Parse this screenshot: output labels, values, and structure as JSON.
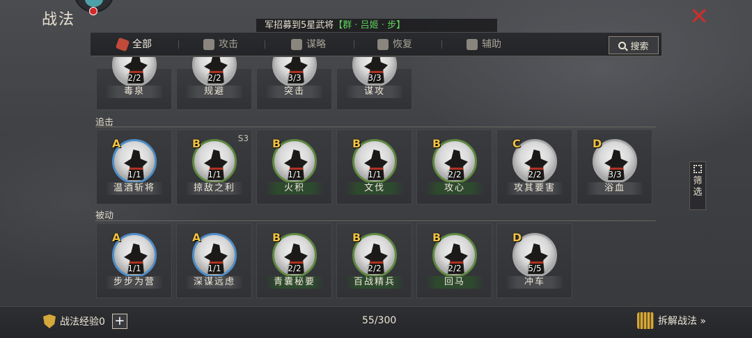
{
  "header": {
    "title": "战法",
    "marquee_prefix": "军招募到5星武将",
    "marquee_highlight": "【群 · 吕姬 · 步】"
  },
  "tabs": [
    {
      "label": "全部",
      "icon": "scroll-icon",
      "active": true
    },
    {
      "label": "攻击",
      "icon": "crossed-swords-icon",
      "active": false
    },
    {
      "label": "谋略",
      "icon": "fan-icon",
      "active": false
    },
    {
      "label": "恢复",
      "icon": "pot-icon",
      "active": false
    },
    {
      "label": "辅助",
      "icon": "bag-icon",
      "active": false
    }
  ],
  "search_label": "搜索",
  "filter_label": "筛选",
  "top_row": [
    {
      "count": "2/2",
      "name": "毒泉"
    },
    {
      "count": "2/2",
      "name": "规避"
    },
    {
      "count": "3/3",
      "name": "突击"
    },
    {
      "count": "3/3",
      "name": "谋攻"
    }
  ],
  "sections": [
    {
      "label": "追击",
      "cards": [
        {
          "grade": "A",
          "count": "1/1",
          "name": "温酒斩将",
          "ring": "blue",
          "season": ""
        },
        {
          "grade": "B",
          "count": "1/1",
          "name": "掠敌之利",
          "ring": "green",
          "season": "S3"
        },
        {
          "grade": "B",
          "count": "1/1",
          "name": "火积",
          "ring": "green",
          "season": ""
        },
        {
          "grade": "B",
          "count": "1/1",
          "name": "文伐",
          "ring": "green",
          "season": ""
        },
        {
          "grade": "B",
          "count": "2/2",
          "name": "攻心",
          "ring": "green",
          "season": ""
        },
        {
          "grade": "C",
          "count": "2/2",
          "name": "攻其要害",
          "ring": "grey",
          "season": ""
        },
        {
          "grade": "D",
          "count": "3/3",
          "name": "浴血",
          "ring": "grey",
          "season": ""
        }
      ]
    },
    {
      "label": "被动",
      "cards": [
        {
          "grade": "A",
          "count": "1/1",
          "name": "步步为营",
          "ring": "blue",
          "season": ""
        },
        {
          "grade": "A",
          "count": "1/1",
          "name": "深谋远虑",
          "ring": "blue",
          "season": ""
        },
        {
          "grade": "B",
          "count": "2/2",
          "name": "青囊秘要",
          "ring": "green",
          "season": ""
        },
        {
          "grade": "B",
          "count": "2/2",
          "name": "百战精兵",
          "ring": "green",
          "season": ""
        },
        {
          "grade": "B",
          "count": "2/2",
          "name": "回马",
          "ring": "green",
          "season": ""
        },
        {
          "grade": "D",
          "count": "5/5",
          "name": "冲车",
          "ring": "grey",
          "season": ""
        }
      ]
    }
  ],
  "footer": {
    "exp_label": "战法经验0",
    "plus": "+",
    "pager": "55/300",
    "dismantle_label": "拆解战法 »"
  }
}
